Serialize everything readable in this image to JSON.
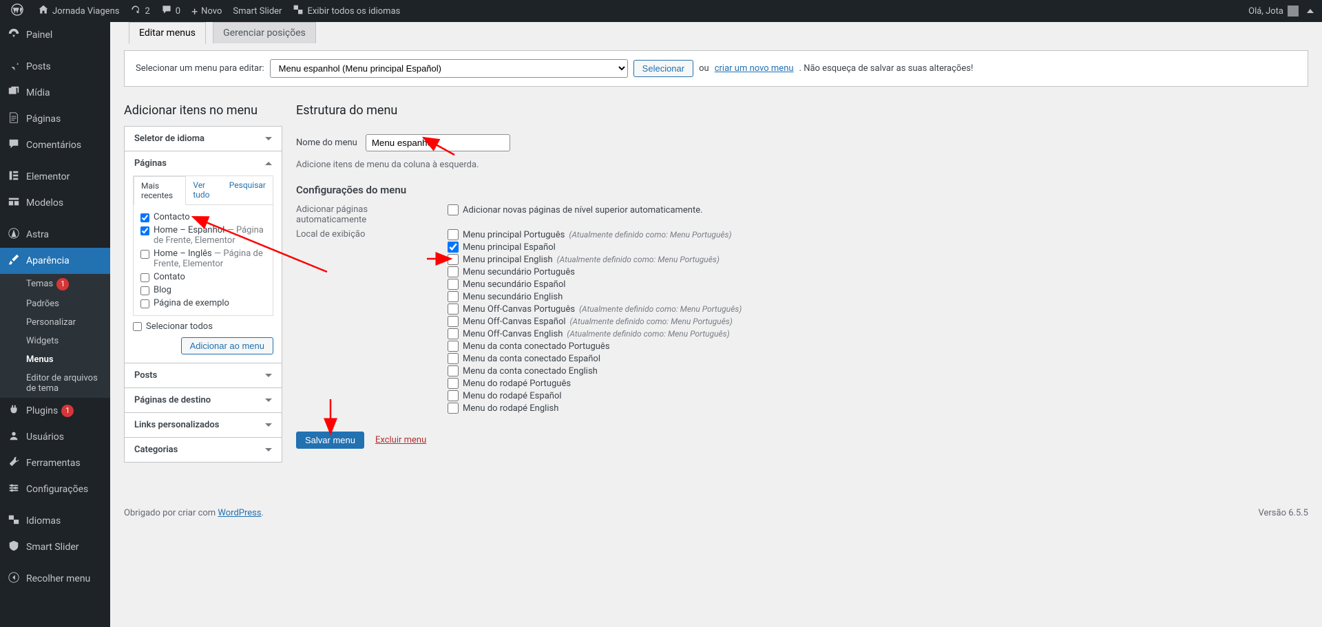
{
  "adminbar": {
    "site_name": "Jornada Viagens",
    "updates_count": "2",
    "comments_count": "0",
    "new_label": "Novo",
    "smart_slider": "Smart Slider",
    "show_all_languages": "Exibir todos os idiomas",
    "greeting": "Olá, Jota"
  },
  "sidebar": {
    "painel": "Painel",
    "posts": "Posts",
    "midia": "Mídia",
    "paginas": "Páginas",
    "comentarios": "Comentários",
    "elementor": "Elementor",
    "modelos": "Modelos",
    "astra": "Astra",
    "aparencia": "Aparência",
    "temas": "Temas",
    "temas_badge": "1",
    "padroes": "Padrões",
    "personalizar": "Personalizar",
    "widgets": "Widgets",
    "menus": "Menus",
    "editor_arquivos": "Editor de arquivos de tema",
    "plugins": "Plugins",
    "plugins_badge": "1",
    "usuarios": "Usuários",
    "ferramentas": "Ferramentas",
    "configuracoes": "Configurações",
    "idiomas": "Idiomas",
    "smart_slider": "Smart Slider",
    "recolher": "Recolher menu"
  },
  "tabs": {
    "edit": "Editar menus",
    "manage": "Gerenciar posições"
  },
  "manage": {
    "select_label": "Selecionar um menu para editar:",
    "select_value": "Menu espanhol (Menu principal Español)",
    "select_btn": "Selecionar",
    "or": "ou",
    "create_link": "criar um novo menu",
    "dont_forget": ". Não esqueça de salvar as suas alterações!"
  },
  "left_col": {
    "title": "Adicionar itens no menu",
    "selector_idioma": "Seletor de idioma",
    "paginas": "Páginas",
    "posts": "Posts",
    "landing": "Páginas de destino",
    "custom_links": "Links personalizados",
    "categorias": "Categorias",
    "tab_recent": "Mais recentes",
    "tab_all": "Ver tudo",
    "tab_search": "Pesquisar",
    "pages": [
      {
        "label": "Contacto",
        "checked": true,
        "suffix": ""
      },
      {
        "label": "Home – Espanhol",
        "checked": true,
        "suffix": " — Página de Frente, Elementor"
      },
      {
        "label": "Home – Inglês",
        "checked": false,
        "suffix": " — Página de Frente, Elementor"
      },
      {
        "label": "Contato",
        "checked": false,
        "suffix": ""
      },
      {
        "label": "Blog",
        "checked": false,
        "suffix": ""
      },
      {
        "label": "Página de exemplo",
        "checked": false,
        "suffix": ""
      }
    ],
    "select_all": "Selecionar todos",
    "add_to_menu": "Adicionar ao menu"
  },
  "right_col": {
    "title": "Estrutura do menu",
    "name_label": "Nome do menu",
    "name_value": "Menu espanhol",
    "help": "Adicione itens de menu da coluna à esquerda.",
    "settings_title": "Configurações do menu",
    "auto_add_label": "Adicionar páginas automaticamente",
    "auto_add_cb": "Adicionar novas páginas de nível superior automaticamente.",
    "display_loc_label": "Local de exibição",
    "locations": [
      {
        "label": "Menu principal Português",
        "note": "(Atualmente definido como: Menu Português)",
        "checked": false
      },
      {
        "label": "Menu principal Español",
        "note": "",
        "checked": true
      },
      {
        "label": "Menu principal English",
        "note": "(Atualmente definido como: Menu Português)",
        "checked": false
      },
      {
        "label": "Menu secundário Português",
        "note": "",
        "checked": false
      },
      {
        "label": "Menu secundário Español",
        "note": "",
        "checked": false
      },
      {
        "label": "Menu secundário English",
        "note": "",
        "checked": false
      },
      {
        "label": "Menu Off-Canvas Português",
        "note": "(Atualmente definido como: Menu Português)",
        "checked": false
      },
      {
        "label": "Menu Off-Canvas Español",
        "note": "(Atualmente definido como: Menu Português)",
        "checked": false
      },
      {
        "label": "Menu Off-Canvas English",
        "note": "(Atualmente definido como: Menu Português)",
        "checked": false
      },
      {
        "label": "Menu da conta conectado Português",
        "note": "",
        "checked": false
      },
      {
        "label": "Menu da conta conectado Español",
        "note": "",
        "checked": false
      },
      {
        "label": "Menu da conta conectado English",
        "note": "",
        "checked": false
      },
      {
        "label": "Menu do rodapé Português",
        "note": "",
        "checked": false
      },
      {
        "label": "Menu do rodapé Español",
        "note": "",
        "checked": false
      },
      {
        "label": "Menu do rodapé English",
        "note": "",
        "checked": false
      }
    ],
    "save_btn": "Salvar menu",
    "delete_link": "Excluir menu"
  },
  "footer": {
    "thanks": "Obrigado por criar com ",
    "wp": "WordPress",
    "period": ".",
    "version": "Versão 6.5.5"
  }
}
